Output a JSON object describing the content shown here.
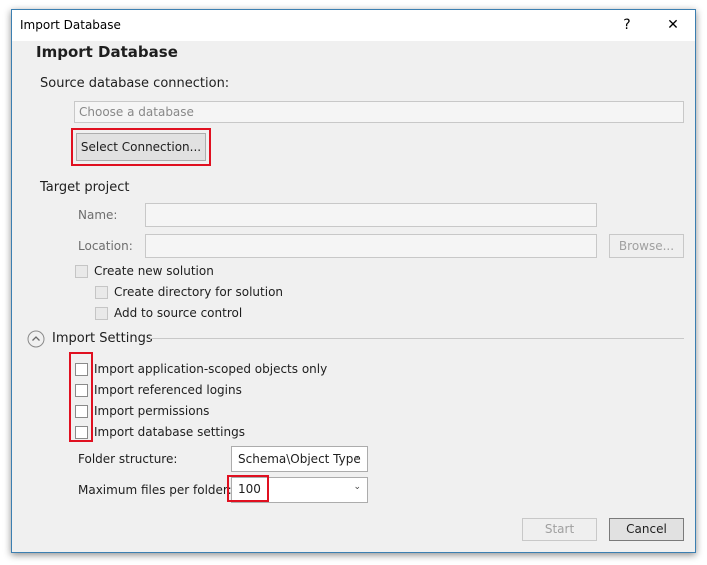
{
  "window": {
    "title": "Import Database",
    "help_label": "?",
    "close_label": "✕"
  },
  "heading": "Import Database",
  "source": {
    "label": "Source database connection:",
    "placeholder": "Choose a database",
    "select_button": "Select Connection..."
  },
  "target": {
    "label": "Target project",
    "name_label": "Name:",
    "name_value": "",
    "location_label": "Location:",
    "location_value": "",
    "browse_button": "Browse...",
    "create_solution": "Create new solution",
    "create_directory": "Create directory for solution",
    "add_source_control": "Add to source control"
  },
  "import_settings": {
    "label": "Import Settings",
    "toggle_icon": "chevron-up-icon",
    "options": [
      {
        "label": "Import application-scoped objects only",
        "checked": false
      },
      {
        "label": "Import referenced logins",
        "checked": false
      },
      {
        "label": "Import permissions",
        "checked": false
      },
      {
        "label": "Import database settings",
        "checked": false
      }
    ],
    "folder_structure_label": "Folder structure:",
    "folder_structure_value": "Schema\\Object Type",
    "max_files_label": "Maximum files per folder:",
    "max_files_value": "100"
  },
  "footer": {
    "start_button": "Start",
    "cancel_button": "Cancel"
  },
  "colors": {
    "highlight": "#e01020",
    "window_border": "#3c7fb1",
    "dialog_bg": "#f0f0f0"
  }
}
